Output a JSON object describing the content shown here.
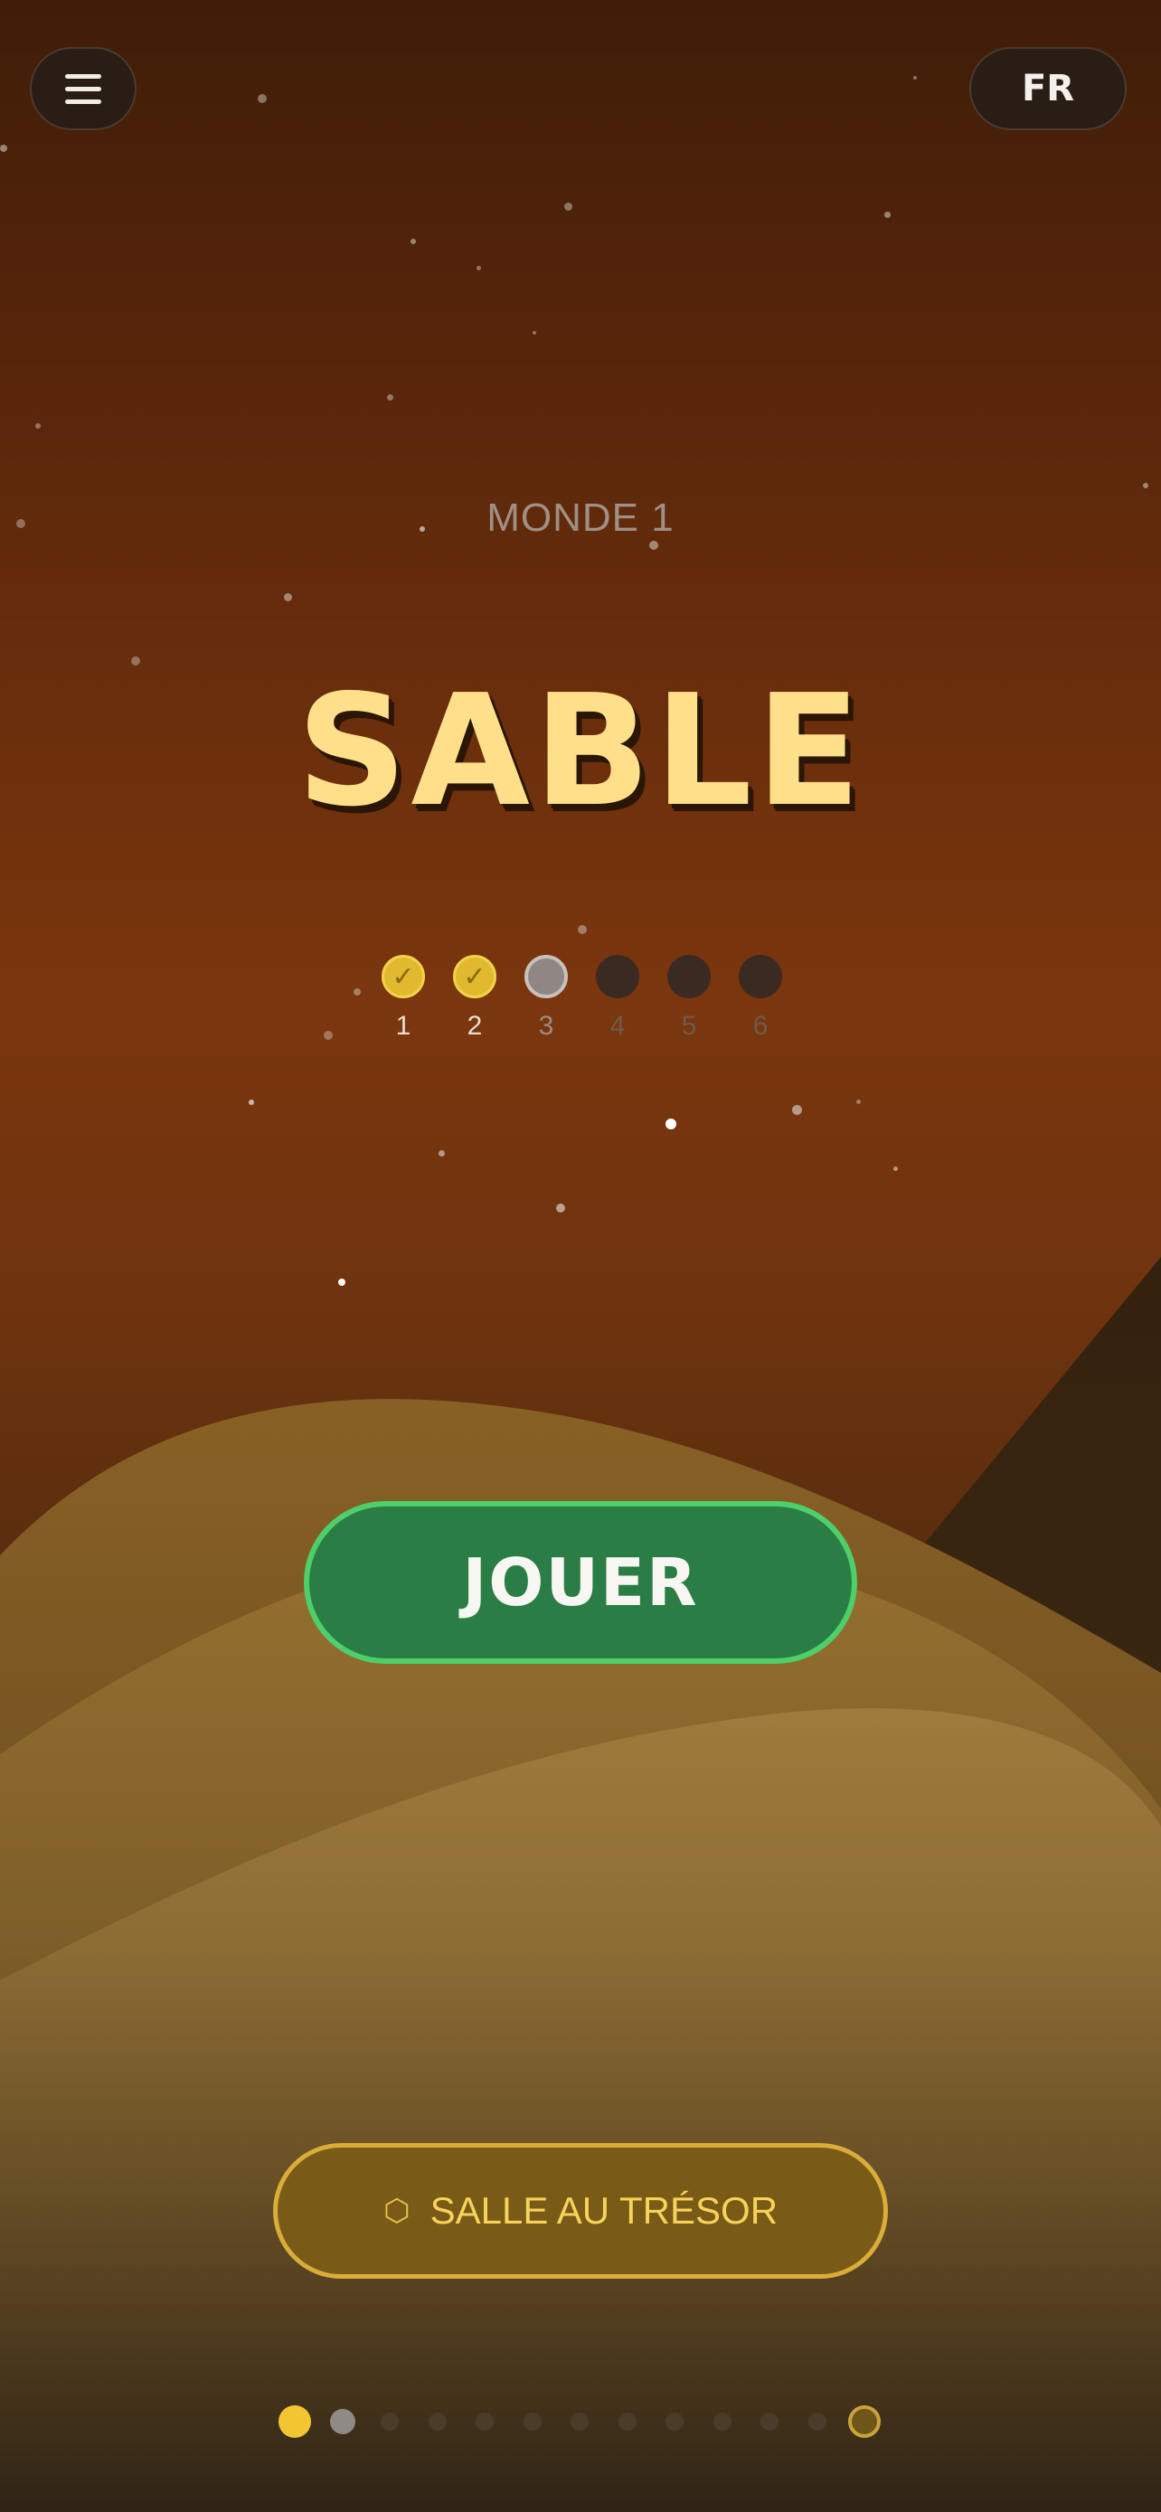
{
  "header": {
    "menu_icon": "hamburger-menu-icon",
    "language": "FR"
  },
  "world": {
    "label": "MONDE 1",
    "title": "SABLE"
  },
  "levels": [
    {
      "number": "1",
      "state": "completed",
      "mark": "✓"
    },
    {
      "number": "2",
      "state": "completed",
      "mark": "✓"
    },
    {
      "number": "3",
      "state": "current",
      "mark": ""
    },
    {
      "number": "4",
      "state": "locked",
      "mark": ""
    },
    {
      "number": "5",
      "state": "locked",
      "mark": ""
    },
    {
      "number": "6",
      "state": "locked",
      "mark": ""
    }
  ],
  "actions": {
    "play_label": "JOUER",
    "treasure_icon": "hexagon-icon",
    "treasure_glyph": "⬡",
    "treasure_label": "SALLE AU TRÉSOR"
  },
  "pager": {
    "total_pages": 13,
    "current_page": 1,
    "last_page_style": "treasure"
  },
  "colors": {
    "title": "#ffe08a",
    "play_button": "#2a7e45",
    "play_border": "#4fcf6a",
    "treasure_button": "#7a5a17",
    "treasure_border": "#d9ad38",
    "level_done": "#e1b92e"
  }
}
